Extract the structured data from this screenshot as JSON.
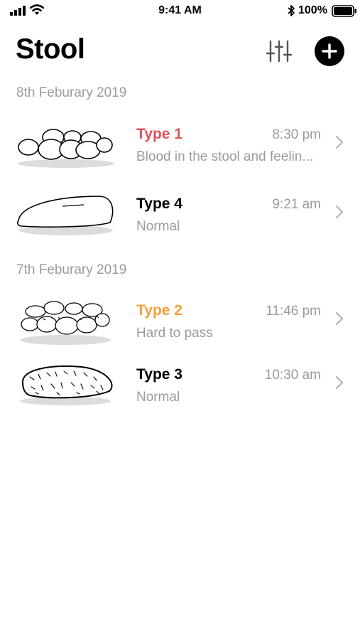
{
  "status_bar": {
    "time": "9:41 AM",
    "battery_percent": "100%"
  },
  "header": {
    "title": "Stool",
    "filter_icon": "sliders-icon",
    "add_icon": "plus-icon"
  },
  "colors": {
    "type1_red": "#e0525c",
    "type2_orange": "#f5a03a",
    "muted": "#9b9b9b"
  },
  "sections": [
    {
      "date": "8th Feburary 2019",
      "entries": [
        {
          "type": "Type 1",
          "time": "8:30 pm",
          "note": "Blood in the stool and feelin...",
          "illustration": "separate-lumps"
        },
        {
          "type": "Type 4",
          "time": "9:21 am",
          "note": "Normal",
          "illustration": "smooth-sausage"
        }
      ]
    },
    {
      "date": "7th Feburary 2019",
      "entries": [
        {
          "type": "Type 2",
          "time": "11:46 pm",
          "note": "Hard to pass",
          "illustration": "lumpy-cluster"
        },
        {
          "type": "Type 3",
          "time": "10:30 am",
          "note": "Normal",
          "illustration": "cracked-sausage"
        }
      ]
    }
  ]
}
